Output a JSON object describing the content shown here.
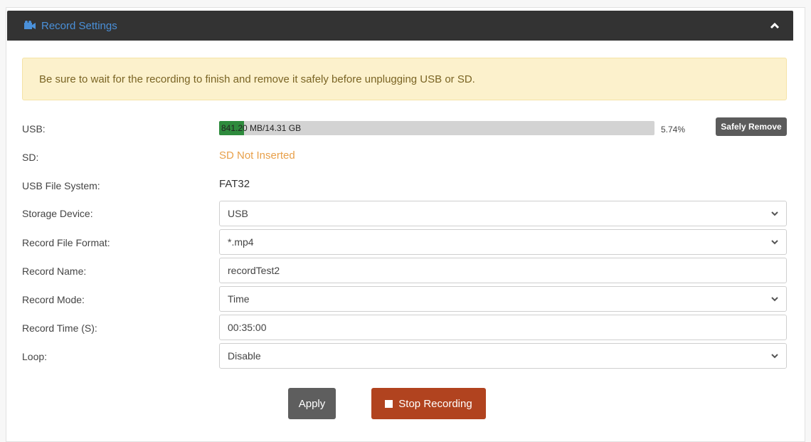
{
  "panel": {
    "title": "Record Settings",
    "icon": "recorder-icon",
    "collapse_icon": "chevron-up-icon"
  },
  "alert": {
    "text": "Be sure to wait for the recording to finish and remove it safely before unplugging USB or SD."
  },
  "usb": {
    "label": "USB:",
    "usage_text": "841.20 MB/14.31 GB",
    "percent_text": "5.74%",
    "percent_value": 5.74,
    "safely_remove_label": "Safely Remove"
  },
  "sd": {
    "label": "SD:",
    "status": "SD Not Inserted"
  },
  "usb_fs": {
    "label": "USB File System:",
    "value": "FAT32"
  },
  "storage_device": {
    "label": "Storage Device:",
    "value": "USB"
  },
  "record_format": {
    "label": "Record File Format:",
    "value": "*.mp4"
  },
  "record_name": {
    "label": "Record Name:",
    "value": "recordTest2"
  },
  "record_mode": {
    "label": "Record Mode:",
    "value": "Time"
  },
  "record_time": {
    "label": "Record Time (S):",
    "value": "00:35:00"
  },
  "loop": {
    "label": "Loop:",
    "value": "Disable"
  },
  "actions": {
    "apply_label": "Apply",
    "stop_label": "Stop Recording"
  },
  "colors": {
    "header_bg": "#333333",
    "header_title": "#4a90d9",
    "progress_fill": "#2e8b3d",
    "sd_status": "#e8a04a",
    "stop_button": "#b1431f"
  }
}
